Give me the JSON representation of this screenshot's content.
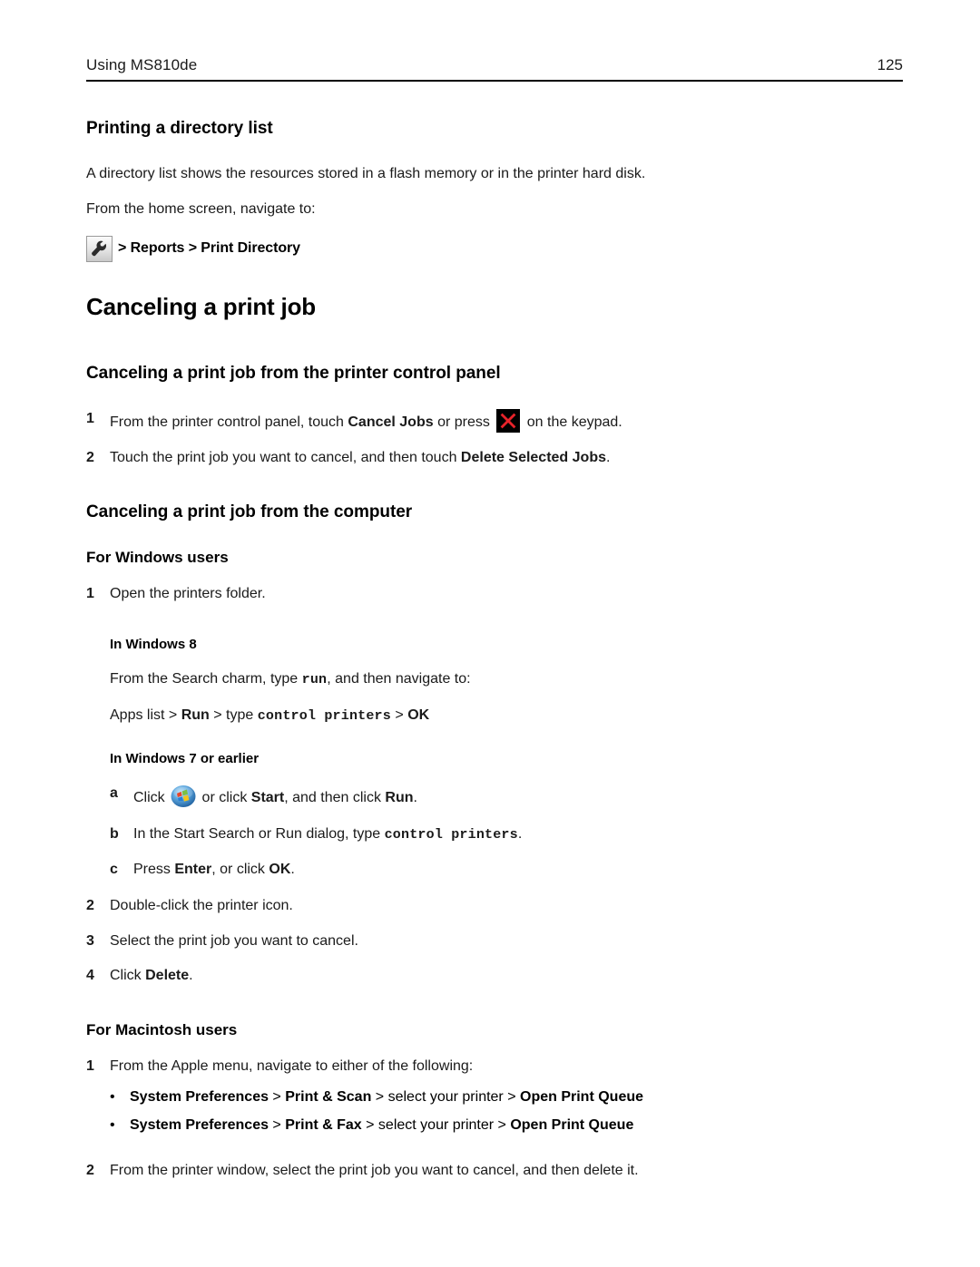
{
  "header": {
    "title": "Using MS810de",
    "page_number": "125"
  },
  "sections": {
    "directory": {
      "heading": "Printing a directory list",
      "intro": "A directory list shows the resources stored in a flash memory or in the printer hard disk.",
      "navigate_intro": "From the home screen, navigate to:",
      "nav_icon": "wrench-icon",
      "nav_path": "> Reports > Print Directory"
    },
    "canceling": {
      "heading": "Canceling a print job",
      "control_panel": {
        "heading": "Canceling a print job from the printer control panel",
        "steps": [
          {
            "marker": "1",
            "text_before": "From the printer control panel, touch ",
            "bold1": "Cancel Jobs",
            "text_mid": " or press ",
            "icon": "cancel-x-icon",
            "text_after": " on the keypad."
          },
          {
            "marker": "2",
            "text_before": "Touch the print job you want to cancel, and then touch ",
            "bold1": "Delete Selected Jobs",
            "text_after": "."
          }
        ]
      },
      "computer": {
        "heading": "Canceling a print job from the computer",
        "windows": {
          "heading": "For Windows users",
          "step1_marker": "1",
          "step1_text": "Open the printers folder.",
          "win8_label": "In Windows 8",
          "win8_line1_a": "From the Search charm, type ",
          "win8_line1_mono": "run",
          "win8_line1_b": ", and then navigate to:",
          "win8_line2_a": "Apps list > ",
          "win8_line2_bold1": "Run",
          "win8_line2_b": " > type ",
          "win8_line2_mono": "control printers",
          "win8_line2_c": " > ",
          "win8_line2_bold2": "OK",
          "win7_label": "In Windows 7 or earlier",
          "win7_steps": [
            {
              "marker": "a",
              "text_before": "Click ",
              "icon": "windows-start-orb-icon",
              "text_mid": " or click ",
              "bold1": "Start",
              "text_mid2": ", and then click ",
              "bold2": "Run",
              "text_after": "."
            },
            {
              "marker": "b",
              "text_before": "In the Start Search or Run dialog, type ",
              "mono": "control printers",
              "text_after": "."
            },
            {
              "marker": "c",
              "text_before": "Press ",
              "bold1": "Enter",
              "text_mid": ", or click ",
              "bold2": "OK",
              "text_after": "."
            }
          ],
          "steps_rest": [
            {
              "marker": "2",
              "text": "Double-click the printer icon."
            },
            {
              "marker": "3",
              "text": "Select the print job you want to cancel."
            },
            {
              "marker": "4",
              "text_before": "Click ",
              "bold1": "Delete",
              "text_after": "."
            }
          ]
        },
        "macintosh": {
          "heading": "For Macintosh users",
          "step1_marker": "1",
          "step1_text": "From the Apple menu, navigate to either of the following:",
          "bullets": [
            {
              "bullet": "•",
              "bold1": "System Preferences",
              "sep1": " > ",
              "bold2": "Print & Scan",
              "sep2": " > select your printer > ",
              "bold3": "Open Print Queue"
            },
            {
              "bullet": "•",
              "bold1": "System Preferences",
              "sep1": " > ",
              "bold2": "Print & Fax",
              "sep2": " > select your printer > ",
              "bold3": "Open Print Queue"
            }
          ],
          "step2_marker": "2",
          "step2_text": "From the printer window, select the print job you want to cancel, and then delete it."
        }
      }
    }
  },
  "colors": {
    "text": "#1a1a1a",
    "rule": "#000000",
    "cancel_icon_bg": "#000000",
    "cancel_icon_x": "#e8232a",
    "win_orb_blue": "#3f93d6",
    "win_flag_red": "#e8452a",
    "win_flag_green": "#7bc043",
    "win_flag_blue": "#2a7fd4",
    "win_flag_yellow": "#f5c518"
  }
}
